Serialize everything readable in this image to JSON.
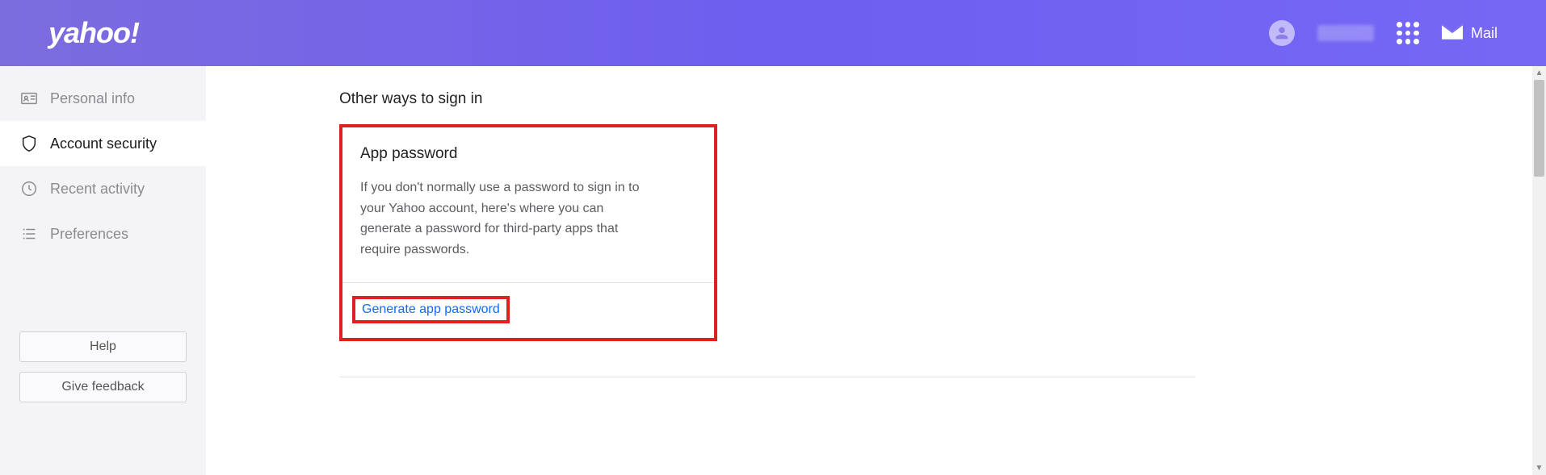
{
  "header": {
    "logo_text": "yahoo!",
    "mail_label": "Mail"
  },
  "sidebar": {
    "items": [
      {
        "label": "Personal info"
      },
      {
        "label": "Account security"
      },
      {
        "label": "Recent activity"
      },
      {
        "label": "Preferences"
      }
    ],
    "help_label": "Help",
    "feedback_label": "Give feedback"
  },
  "content": {
    "section_title": "Other ways to sign in",
    "card": {
      "title": "App password",
      "description": "If you don't normally use a password to sign in to your Yahoo account, here's where you can generate a password for third-party apps that require passwords.",
      "action_label": "Generate app password"
    }
  }
}
